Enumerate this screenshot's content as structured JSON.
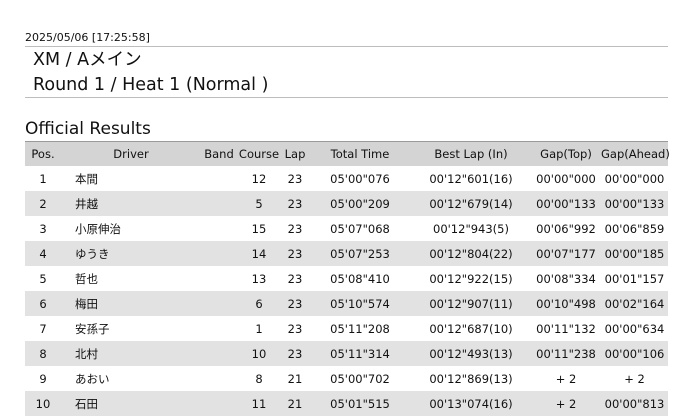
{
  "timestamp": "2025/05/06 [17:25:58]",
  "class_line": "XM / Aメイン",
  "round_line": "Round 1 / Heat 1 (Normal )",
  "results_title": "Official Results",
  "columns": {
    "pos": "Pos.",
    "driver": "Driver",
    "band": "Band",
    "course": "Course",
    "lap": "Lap",
    "total": "Total Time",
    "best": "Best Lap (In)",
    "gap_top": "Gap(Top)",
    "gap_ahead": "Gap(Ahead)"
  },
  "rows": [
    {
      "pos": "1",
      "driver": "本間",
      "band": "",
      "course": "12",
      "lap": "23",
      "total": "05'00\"076",
      "best": "00'12\"601(16)",
      "gap_top": "00'00\"000",
      "gap_ahead": "00'00\"000"
    },
    {
      "pos": "2",
      "driver": "井越",
      "band": "",
      "course": "5",
      "lap": "23",
      "total": "05'00\"209",
      "best": "00'12\"679(14)",
      "gap_top": "00'00\"133",
      "gap_ahead": "00'00\"133"
    },
    {
      "pos": "3",
      "driver": "小原伸治",
      "band": "",
      "course": "15",
      "lap": "23",
      "total": "05'07\"068",
      "best": "00'12\"943(5)",
      "gap_top": "00'06\"992",
      "gap_ahead": "00'06\"859"
    },
    {
      "pos": "4",
      "driver": "ゆうき",
      "band": "",
      "course": "14",
      "lap": "23",
      "total": "05'07\"253",
      "best": "00'12\"804(22)",
      "gap_top": "00'07\"177",
      "gap_ahead": "00'00\"185"
    },
    {
      "pos": "5",
      "driver": "哲也",
      "band": "",
      "course": "13",
      "lap": "23",
      "total": "05'08\"410",
      "best": "00'12\"922(15)",
      "gap_top": "00'08\"334",
      "gap_ahead": "00'01\"157"
    },
    {
      "pos": "6",
      "driver": "梅田",
      "band": "",
      "course": "6",
      "lap": "23",
      "total": "05'10\"574",
      "best": "00'12\"907(11)",
      "gap_top": "00'10\"498",
      "gap_ahead": "00'02\"164"
    },
    {
      "pos": "7",
      "driver": "安孫子",
      "band": "",
      "course": "1",
      "lap": "23",
      "total": "05'11\"208",
      "best": "00'12\"687(10)",
      "gap_top": "00'11\"132",
      "gap_ahead": "00'00\"634"
    },
    {
      "pos": "8",
      "driver": "北村",
      "band": "",
      "course": "10",
      "lap": "23",
      "total": "05'11\"314",
      "best": "00'12\"493(13)",
      "gap_top": "00'11\"238",
      "gap_ahead": "00'00\"106"
    },
    {
      "pos": "9",
      "driver": "あおい",
      "band": "",
      "course": "8",
      "lap": "21",
      "total": "05'00\"702",
      "best": "00'12\"869(13)",
      "gap_top": "+ 2",
      "gap_ahead": "+ 2"
    },
    {
      "pos": "10",
      "driver": "石田",
      "band": "",
      "course": "11",
      "lap": "21",
      "total": "05'01\"515",
      "best": "00'13\"074(16)",
      "gap_top": "+ 2",
      "gap_ahead": "00'00\"813"
    }
  ]
}
